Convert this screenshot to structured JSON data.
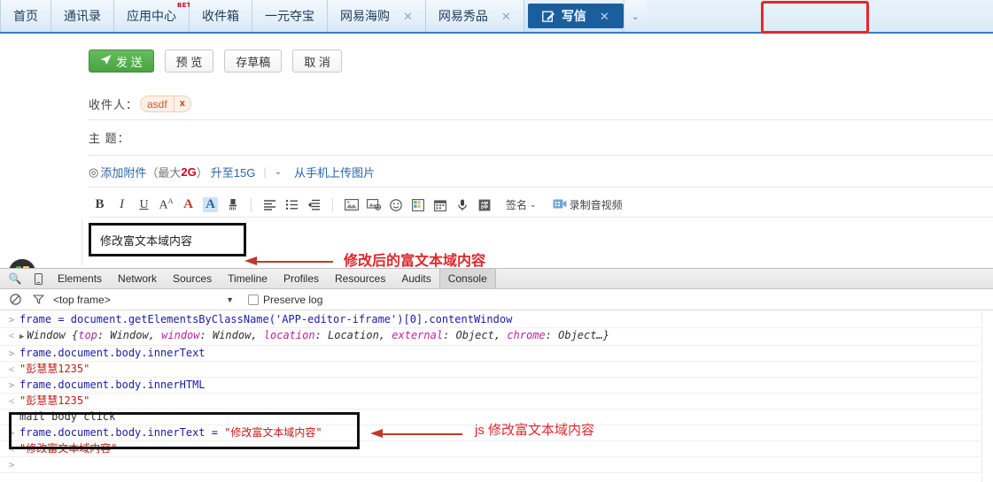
{
  "browser_tabs": {
    "items": [
      {
        "label": "首页",
        "badge": "",
        "closable": false,
        "active": false
      },
      {
        "label": "通讯录",
        "badge": "",
        "closable": false,
        "active": false
      },
      {
        "label": "应用中心",
        "badge": "BETA",
        "closable": false,
        "active": false
      },
      {
        "label": "收件箱",
        "badge": "",
        "closable": false,
        "active": false
      },
      {
        "label": "一元夺宝",
        "badge": "",
        "closable": false,
        "active": false
      },
      {
        "label": "网易海购",
        "badge": "",
        "closable": true,
        "active": false
      },
      {
        "label": "网易秀品",
        "badge": "",
        "closable": true,
        "active": false
      },
      {
        "label": "写信",
        "badge": "",
        "closable": true,
        "active": true
      }
    ],
    "close_glyph": "✕",
    "overflow_caret": "⌄",
    "highlight_color": "#e8262d",
    "active_bg": "#1b5e9e"
  },
  "compose": {
    "buttons": [
      {
        "name": "send",
        "label": "发 送",
        "icon": "paper-plane-icon",
        "primary": true
      },
      {
        "name": "preview",
        "label": "预 览",
        "icon": "",
        "primary": false
      },
      {
        "name": "save-draft",
        "label": "存草稿",
        "icon": "",
        "primary": false
      },
      {
        "name": "cancel",
        "label": "取 消",
        "icon": "",
        "primary": false
      }
    ],
    "to_field": {
      "label": "收件人：",
      "chips": [
        {
          "text": "asdf",
          "remove_glyph": "x"
        }
      ]
    },
    "subject_field": {
      "label": "主  题：",
      "value": "",
      "placeholder": ""
    },
    "attach": {
      "icon_glyph": "◎",
      "add_label": "添加附件",
      "size_prefix": "（最大",
      "size_value": "2G",
      "size_suffix": "）",
      "upgrade_label": "升至15G",
      "separator": "|",
      "caret": "⌄",
      "phone_upload_label": "从手机上传图片"
    },
    "editor_toolbar": {
      "items": [
        {
          "name": "bold-icon",
          "glyph": "B",
          "style": "bold"
        },
        {
          "name": "italic-icon",
          "glyph": "I",
          "style": "italic"
        },
        {
          "name": "underline-icon",
          "glyph": "U",
          "style": "underline"
        },
        {
          "name": "font-size-icon",
          "glyph": "A",
          "style": "sup"
        },
        {
          "name": "font-color-icon",
          "glyph": "A",
          "style": "red"
        },
        {
          "name": "highlight-color-icon",
          "glyph": "A",
          "style": "highlight"
        },
        {
          "name": "clear-format-icon",
          "glyph": "🖌",
          "style": "brush"
        },
        {
          "name": "separator-1",
          "glyph": "",
          "style": "sep"
        },
        {
          "name": "align-icon",
          "glyph": "≡",
          "style": "plain"
        },
        {
          "name": "bullet-list-icon",
          "glyph": "☰",
          "style": "list"
        },
        {
          "name": "indent-icon",
          "glyph": "⇤",
          "style": "plain"
        },
        {
          "name": "separator-2",
          "glyph": "",
          "style": "sep"
        },
        {
          "name": "insert-image-icon",
          "glyph": "🖼",
          "style": "box"
        },
        {
          "name": "insert-card-icon",
          "glyph": "▣",
          "style": "box"
        },
        {
          "name": "emoji-icon",
          "glyph": "☺",
          "style": "plain"
        },
        {
          "name": "insert-table-icon",
          "glyph": "▤",
          "style": "box"
        },
        {
          "name": "calendar-icon",
          "glyph": "▦",
          "style": "box"
        },
        {
          "name": "voice-icon",
          "glyph": "🎤",
          "style": "plain"
        },
        {
          "name": "translate-icon",
          "glyph": "譯",
          "style": "filled"
        }
      ],
      "signature": {
        "label": "签名",
        "caret": "⌄"
      },
      "record": {
        "icon": "video-record-icon",
        "label": "录制音视频"
      }
    },
    "editor_body": {
      "content": "修改富文本域内容"
    },
    "annotation": {
      "text": "修改后的富文本域内容",
      "color": "#e0262c"
    },
    "float_widget": {
      "name": "app-grid-widget",
      "colors": [
        "#4caf50",
        "#fdd835",
        "#2196f3",
        "#ef9a9a"
      ]
    }
  },
  "devtools": {
    "search_icon": "🔍",
    "device_icon": "device-toolbar-icon",
    "tabs": [
      {
        "label": "Elements",
        "active": false
      },
      {
        "label": "Network",
        "active": false
      },
      {
        "label": "Sources",
        "active": false
      },
      {
        "label": "Timeline",
        "active": false
      },
      {
        "label": "Profiles",
        "active": false
      },
      {
        "label": "Resources",
        "active": false
      },
      {
        "label": "Audits",
        "active": false
      },
      {
        "label": "Console",
        "active": true
      }
    ],
    "filter_bar": {
      "clear_icon": "🚫",
      "filter_icon": "filter-funnel-icon",
      "context": "<top frame>",
      "caret": "▼",
      "preserve_log_label": "Preserve log",
      "preserve_log_checked": false
    },
    "console_lines": [
      {
        "gutter": ">",
        "kind": "input",
        "parts": [
          {
            "t": "frame = document.getElementsByClassName('APP-editor-iframe')[0].contentWindow",
            "c": "code"
          }
        ]
      },
      {
        "gutter": "<",
        "kind": "output",
        "disclosure": "▶",
        "parts": [
          {
            "t": "Window {",
            "c": "obj"
          },
          {
            "t": "top",
            "c": "key"
          },
          {
            "t": ": Window, ",
            "c": "obj"
          },
          {
            "t": "window",
            "c": "key"
          },
          {
            "t": ": Window, ",
            "c": "obj"
          },
          {
            "t": "location",
            "c": "key"
          },
          {
            "t": ": Location, ",
            "c": "obj"
          },
          {
            "t": "external",
            "c": "key"
          },
          {
            "t": ": Object, ",
            "c": "obj"
          },
          {
            "t": "chrome",
            "c": "key"
          },
          {
            "t": ": Object…}",
            "c": "obj"
          }
        ]
      },
      {
        "gutter": ">",
        "kind": "input",
        "parts": [
          {
            "t": "frame.document.body.innerText",
            "c": "code"
          }
        ]
      },
      {
        "gutter": "<",
        "kind": "output",
        "parts": [
          {
            "t": "\"彭慧慧1235\"",
            "c": "str"
          }
        ]
      },
      {
        "gutter": ">",
        "kind": "input",
        "parts": [
          {
            "t": "frame.document.body.innerHTML",
            "c": "code"
          }
        ]
      },
      {
        "gutter": "<",
        "kind": "output",
        "parts": [
          {
            "t": "\"彭慧慧1235\"",
            "c": "str"
          }
        ]
      },
      {
        "gutter": "",
        "kind": "log",
        "parts": [
          {
            "t": "mail body click",
            "c": "plain"
          }
        ]
      },
      {
        "gutter": ">",
        "kind": "input",
        "parts": [
          {
            "t": "frame.document.body.innerText = ",
            "c": "code"
          },
          {
            "t": "\"修改富文本域内容\"",
            "c": "str"
          }
        ]
      },
      {
        "gutter": "<",
        "kind": "output",
        "parts": [
          {
            "t": "\"修改富文本域内容\"",
            "c": "str"
          }
        ]
      },
      {
        "gutter": ">",
        "kind": "prompt",
        "parts": [
          {
            "t": "",
            "c": "code"
          }
        ]
      }
    ],
    "annotation": {
      "text": "js 修改富文本域内容",
      "color": "#e0262c"
    }
  }
}
